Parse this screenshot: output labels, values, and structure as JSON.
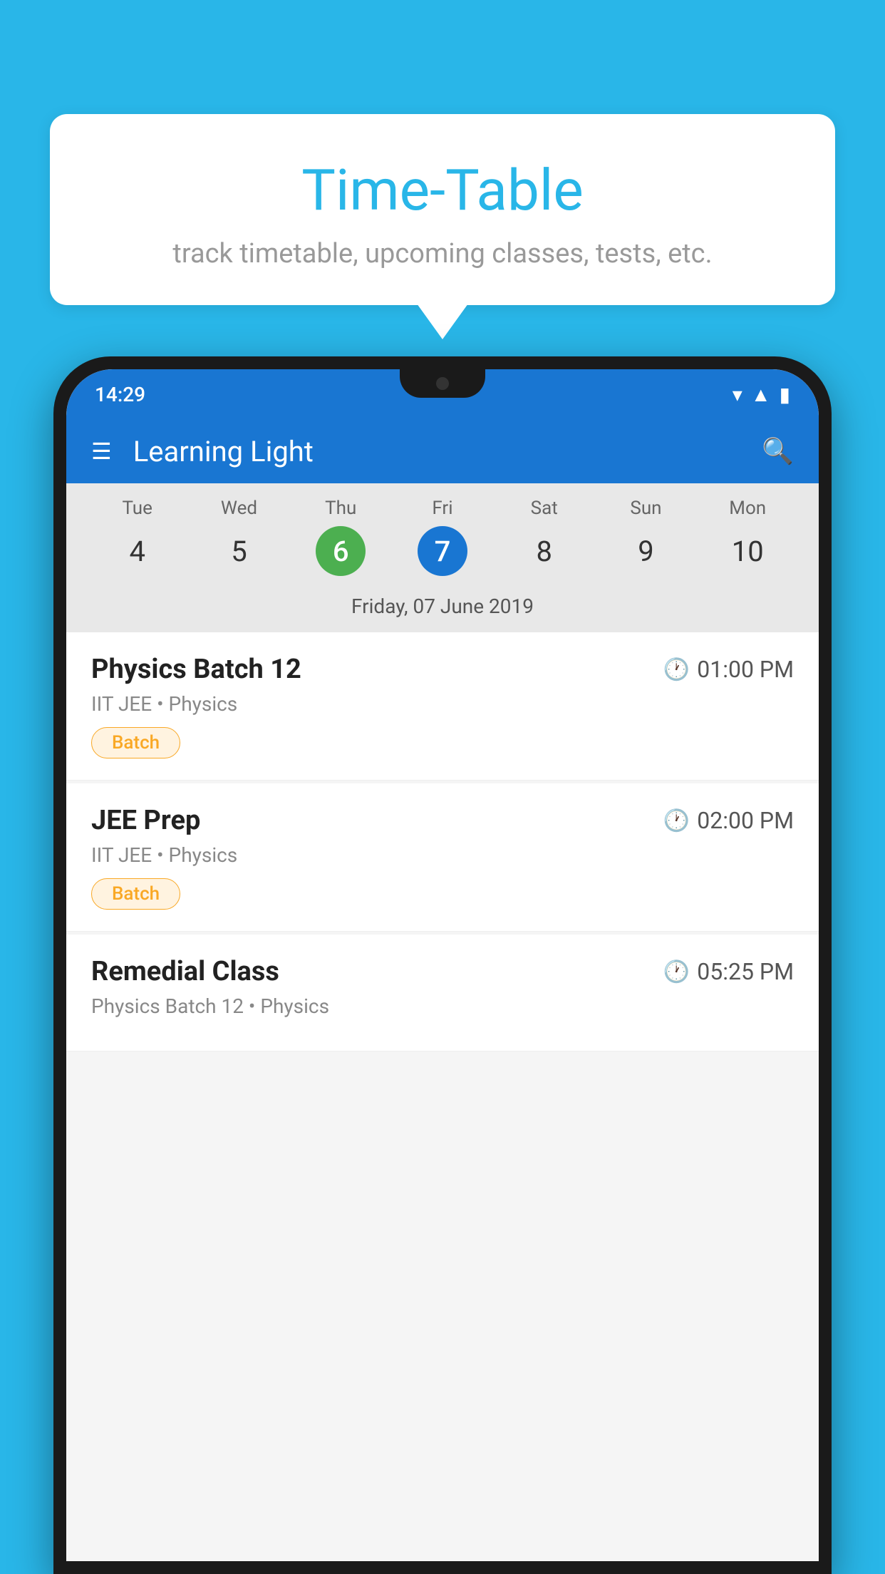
{
  "background_color": "#29B6E8",
  "bubble": {
    "title": "Time-Table",
    "subtitle": "track timetable, upcoming classes, tests, etc."
  },
  "phone": {
    "status_bar": {
      "time": "14:29",
      "icons": [
        "wifi",
        "signal",
        "battery"
      ]
    },
    "header": {
      "title": "Learning Light",
      "menu_icon": "hamburger-icon",
      "search_icon": "search-icon"
    },
    "calendar": {
      "days": [
        {
          "name": "Tue",
          "num": "4",
          "state": "normal"
        },
        {
          "name": "Wed",
          "num": "5",
          "state": "normal"
        },
        {
          "name": "Thu",
          "num": "6",
          "state": "today"
        },
        {
          "name": "Fri",
          "num": "7",
          "state": "selected"
        },
        {
          "name": "Sat",
          "num": "8",
          "state": "normal"
        },
        {
          "name": "Sun",
          "num": "9",
          "state": "normal"
        },
        {
          "name": "Mon",
          "num": "10",
          "state": "normal"
        }
      ],
      "selected_date": "Friday, 07 June 2019"
    },
    "schedule": [
      {
        "name": "Physics Batch 12",
        "time": "01:00 PM",
        "meta": "IIT JEE • Physics",
        "badge": "Batch"
      },
      {
        "name": "JEE Prep",
        "time": "02:00 PM",
        "meta": "IIT JEE • Physics",
        "badge": "Batch"
      },
      {
        "name": "Remedial Class",
        "time": "05:25 PM",
        "meta": "Physics Batch 12 • Physics",
        "badge": null
      }
    ]
  }
}
